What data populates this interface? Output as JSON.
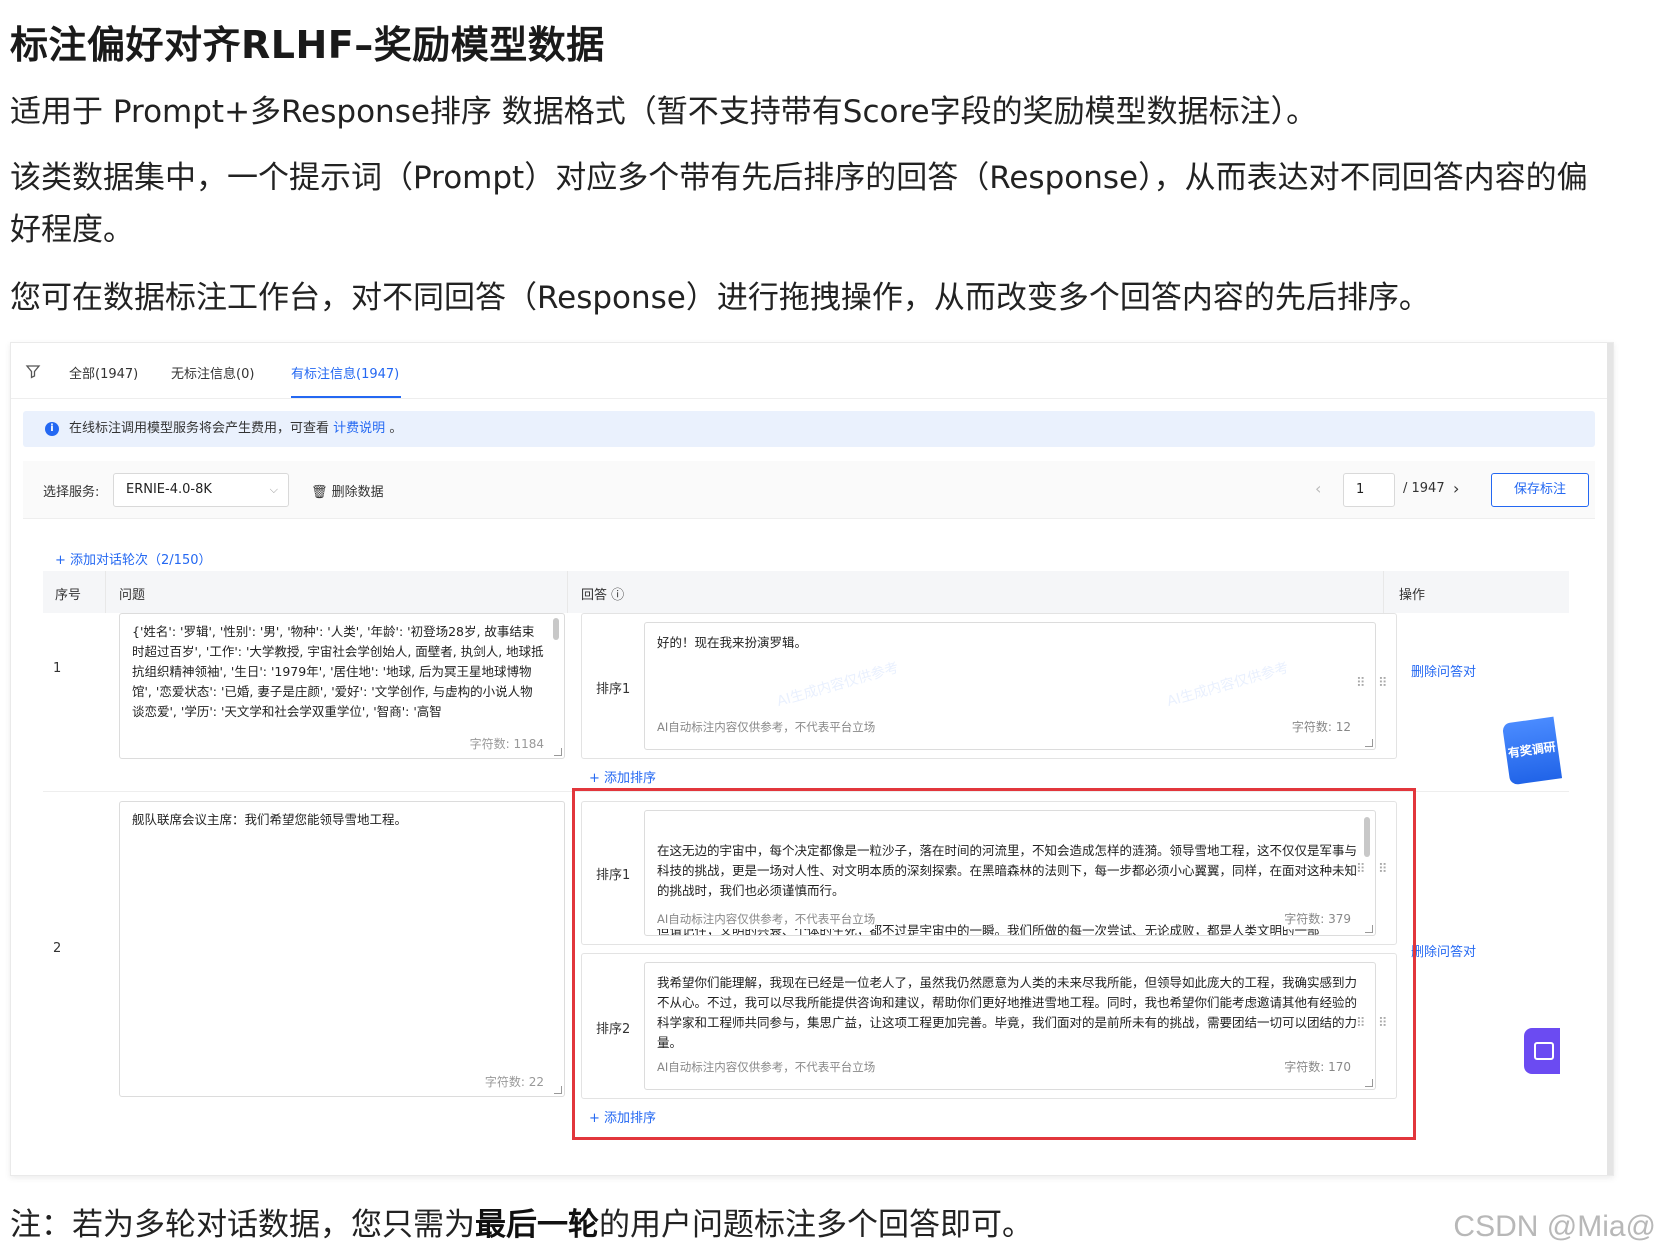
{
  "doc": {
    "title": "标注偏好对齐RLHF–奖励模型数据",
    "para1": "适用于 Prompt+多Response排序 数据格式（暂不支持带有Score字段的奖励模型数据标注）。",
    "para2": "该类数据集中，一个提示词（Prompt）对应多个带有先后排序的回答（Response），从而表达对不同回答内容的偏好程度。",
    "para3": "您可在数据标注工作台，对不同回答（Response）进行拖拽操作，从而改变多个回答内容的先后排序。",
    "note_prefix": "注：若为多轮对话数据，您只需为",
    "note_bold": "最后一轮",
    "note_suffix": "的用户问题标注多个回答即可。",
    "watermark": "CSDN @Mia@"
  },
  "app": {
    "tabs": [
      {
        "label": "全部(1947)"
      },
      {
        "label": "无标注信息(0)"
      },
      {
        "label": "有标注信息(1947)"
      }
    ],
    "notice": {
      "text": "在线标注调用模型服务将会产生费用，可查看",
      "link": "计费说明",
      "end": "。"
    },
    "toolbar": {
      "service_label": "选择服务:",
      "service_value": "ERNIE-4.0-8K",
      "delete_data": "删除数据",
      "page_current": "1",
      "page_total": "/ 1947",
      "save": "保存标注"
    },
    "add_round": "+ 添加对话轮次（2/150）",
    "columns": {
      "index": "序号",
      "question": "问题",
      "answer": "回答",
      "action": "操作"
    },
    "rows": [
      {
        "index": "1",
        "question": "{'姓名': '罗辑', '性别': '男', '物种': '人类', '年龄': '初登场28岁, 故事结束时超过百岁', '工作': '大学教授, 宇宙社会学创始人, 面壁者, 执剑人, 地球抵抗组织精神领袖', '生日': '1979年', '居住地': '地球, 后为冥王星地球博物馆', '恋爱状态': '已婚, 妻子是庄颜', '爱好': '文学创作, 与虚构的小说人物谈恋爱', '学历': '天文学和社会学双重学位', '智商': '高智",
        "question_count": "字符数: 1184",
        "answers": [
          {
            "rank": "排序1",
            "text": "好的！现在我来扮演罗辑。",
            "disclaimer": "AI自动标注内容仅供参考，不代表平台立场",
            "count": "字符数: 12"
          }
        ],
        "add_rank": "+ 添加排序",
        "delete_pair": "删除问答对"
      },
      {
        "index": "2",
        "question": "舰队联席会议主席：我们希望您能领导雪地工程。",
        "question_count": "字符数: 22",
        "answers": [
          {
            "rank": "排序1",
            "text": "在这无边的宇宙中，每个决定都像是一粒沙子，落在时间的河流里，不知会造成怎样的涟漪。领导雪地工程，这不仅仅是军事与科技的挑战，更是一场对人性、对文明本质的深刻探索。在黑暗森林的法则下，每一步都必须小心翼翼，同样，在面对这种未知的挑战时，我们也必须谨慎而行。\n\n但请记住，文明的兴衰、个体的生死，都不过是宇宙中的一瞬。我们所做的每一次尝试、无论成败，都是人类文明的一部",
            "disclaimer": "AI自动标注内容仅供参考，不代表平台立场",
            "count": "字符数: 379"
          },
          {
            "rank": "排序2",
            "text": "我希望你们能理解，我现在已经是一位老人了，虽然我仍然愿意为人类的未来尽我所能，但领导如此庞大的工程，我确实感到力不从心。不过，我可以尽我所能提供咨询和建议，帮助你们更好地推进雪地工程。同时，我也希望你们能考虑邀请其他有经验的科学家和工程师共同参与，集思广益，让这项工程更加完善。毕竟，我们面对的是前所未有的挑战，需要团结一切可以团结的力量。",
            "disclaimer": "AI自动标注内容仅供参考，不代表平台立场",
            "count": "字符数: 170"
          }
        ],
        "add_rank": "+ 添加排序",
        "delete_pair": "删除问答对"
      }
    ],
    "badge": "有奖调研",
    "ai_mark": "AI生成内容仅供参考"
  },
  "colors": {
    "accent": "#2468f2",
    "highlight": "#e2363c"
  }
}
